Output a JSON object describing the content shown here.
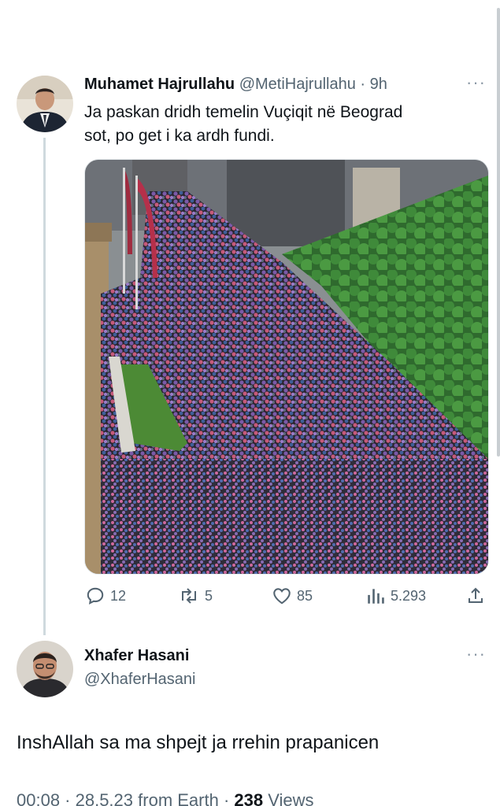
{
  "tweet": {
    "author_name": "Muhamet Hajrullahu",
    "author_handle": "@MetiHajrullahu",
    "separator": "·",
    "time": "9h",
    "text_line1": "Ja paskan dridh temelin Vuçiqit në Beograd",
    "text_line2": "sot, po get i ka ardh fundi.",
    "more_icon": "more-dots-icon",
    "stats": {
      "replies": "12",
      "retweets": "5",
      "likes": "85",
      "views": "5.293"
    }
  },
  "reply": {
    "author_name": "Xhafer Hasani",
    "author_handle": "@XhaferHasani",
    "text": "InshAllah sa ma shpejt ja rrehin prapanicen",
    "meta_time": "00:08 · 28.5.23",
    "meta_source": "from Earth ·",
    "meta_views_count": "238",
    "meta_views_label": "Views"
  },
  "icons": [
    "reply-icon",
    "retweet-icon",
    "like-icon",
    "views-icon",
    "share-icon",
    "more-dots-icon"
  ],
  "colors": {
    "text": "#0f1419",
    "secondary": "#536471",
    "line": "#cfd9de"
  }
}
